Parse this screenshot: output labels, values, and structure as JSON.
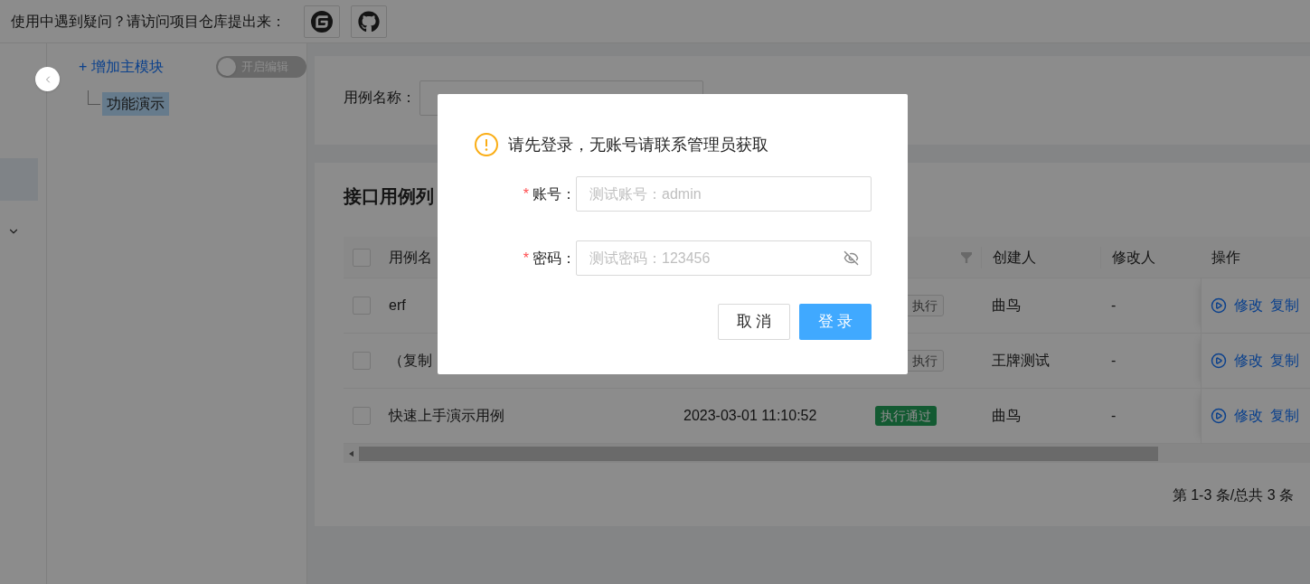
{
  "header": {
    "help_text": "使用中遇到疑问？请访问项目仓库提出来："
  },
  "tree": {
    "add_label": "+ 增加主模块",
    "edit_toggle": {
      "label": "开启编辑",
      "on": false
    },
    "nodes": [
      {
        "label": "功能演示",
        "selected": true
      }
    ]
  },
  "search": {
    "label": "用例名称："
  },
  "table": {
    "title": "接口用例列",
    "header_checked": false,
    "columns": [
      "用例名",
      "创建人",
      "修改人",
      "操作"
    ],
    "rows": [
      {
        "checked": false,
        "name": "erf",
        "status": {
          "label": "执行",
          "kind": "pending"
        },
        "creator": "曲鸟",
        "modifier": "-",
        "actions": [
          "修改",
          "复制"
        ]
      },
      {
        "checked": false,
        "name": "（复制",
        "status": {
          "label": "执行",
          "kind": "pending"
        },
        "creator": "王牌测试",
        "modifier": "-",
        "actions": [
          "修改",
          "复制"
        ]
      },
      {
        "checked": false,
        "name": "快速上手演示用例",
        "date": "2023-03-01 11:10:52",
        "status": {
          "label": "执行通过",
          "kind": "passed"
        },
        "creator": "曲鸟",
        "modifier": "-",
        "actions": [
          "修改",
          "复制"
        ]
      }
    ],
    "pagination": "第 1-3 条/总共 3 条"
  },
  "dialog": {
    "message": "请先登录，无账号请联系管理员获取",
    "fields": [
      {
        "label": "账号：",
        "required_mark": "*",
        "placeholder": "测试账号：admin",
        "kind": "text"
      },
      {
        "label": "密码：",
        "required_mark": "*",
        "placeholder": "测试密码：123456",
        "kind": "password"
      }
    ],
    "buttons": [
      {
        "label": "取 消",
        "kind": "default"
      },
      {
        "label": "登 录",
        "kind": "primary"
      }
    ]
  }
}
